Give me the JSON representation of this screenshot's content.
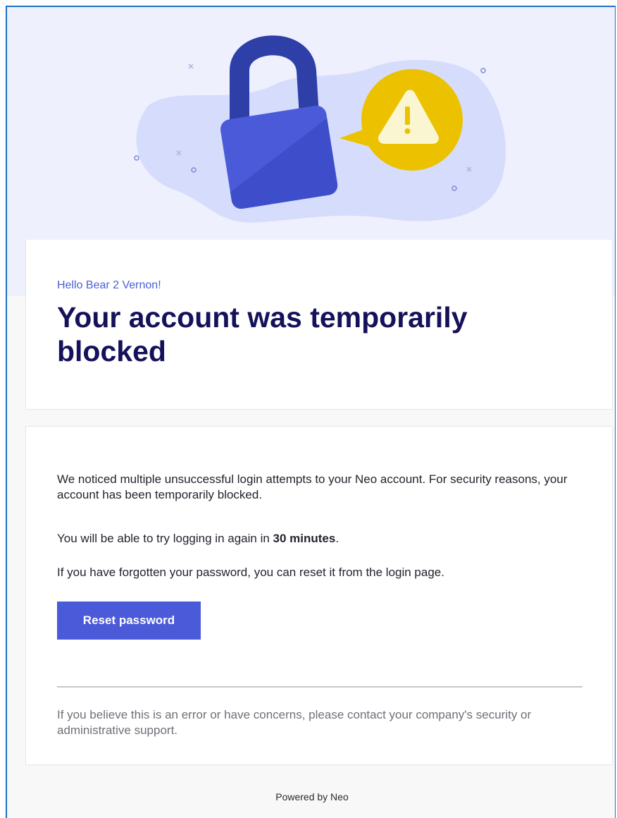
{
  "email": {
    "greeting": "Hello Bear 2 Vernon!",
    "title": "Your account was temporarily blocked",
    "body": {
      "paragraph1": "We noticed multiple unsuccessful login attempts to your Neo account. For security reasons, your account has been temporarily blocked.",
      "paragraph2_prefix": "You will be able to try logging in again in ",
      "paragraph2_bold": "30 minutes",
      "paragraph2_suffix": ".",
      "paragraph3": "If you have forgotten your password, you can reset it from the login page."
    },
    "reset_button_label": "Reset password",
    "footnote": "If you believe this is an error or have concerns, please contact your company's security or administrative support."
  },
  "footer": {
    "powered_by": "Powered by Neo"
  },
  "hero": {
    "icons": [
      "padlock-icon",
      "warning-icon"
    ]
  },
  "colors": {
    "accent": "#4a5ad8",
    "title": "#15115a",
    "warning": "#ecc100",
    "hero_bg": "#eef0fd"
  }
}
